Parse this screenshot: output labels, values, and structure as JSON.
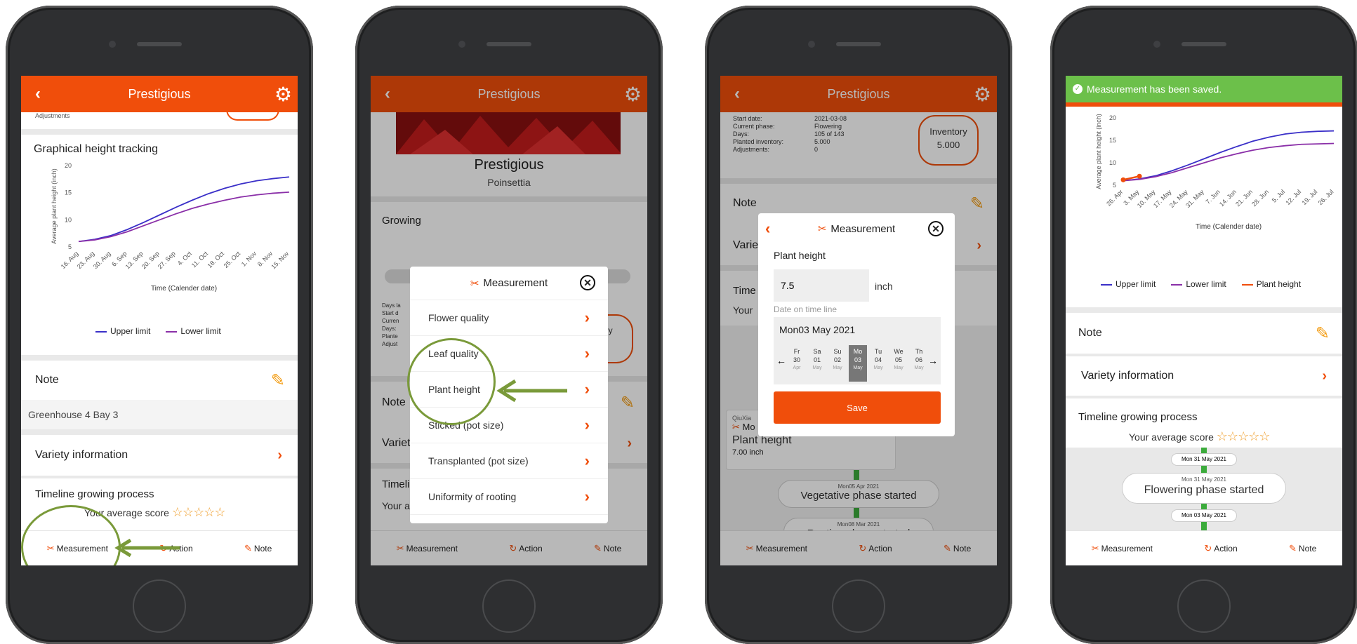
{
  "app": {
    "title": "Prestigious",
    "variety": "Poinsettia"
  },
  "tabs": {
    "measurement": "Measurement",
    "action": "Action",
    "note": "Note"
  },
  "screen1": {
    "adjust_label": "Adjustments",
    "chart_title": "Graphical height tracking",
    "note_label": "Note",
    "note_text": "Greenhouse 4 Bay 3",
    "variety_info": "Variety information",
    "timeline": "Timeline growing process",
    "avg_score": "Your average score"
  },
  "chart_data": [
    {
      "type": "line",
      "title": "Graphical height tracking",
      "xlabel": "Time (Calender date)",
      "ylabel": "Average plant height (inch)",
      "ylim": [
        5,
        20
      ],
      "yticks": [
        5,
        10,
        15,
        20
      ],
      "categories": [
        "16. Aug",
        "23. Aug",
        "30. Aug",
        "6. Sep",
        "13. Sep",
        "20. Sep",
        "27. Sep",
        "4. Oct",
        "11. Oct",
        "18. Oct",
        "25. Oct",
        "1. Nov",
        "8. Nov",
        "15. Nov"
      ],
      "series": [
        {
          "name": "Upper limit",
          "color": "#3a2fc8",
          "values": [
            6,
            6.4,
            7.1,
            8.2,
            9.5,
            10.9,
            12.3,
            13.6,
            14.8,
            15.8,
            16.6,
            17.2,
            17.6,
            17.9
          ]
        },
        {
          "name": "Lower limit",
          "color": "#8a2fa8",
          "values": [
            6,
            6.3,
            6.9,
            7.8,
            8.9,
            10.0,
            11.1,
            12.1,
            12.9,
            13.6,
            14.2,
            14.6,
            14.9,
            15.1
          ]
        }
      ],
      "legend": "bottom"
    },
    {
      "type": "line",
      "xlabel": "Time (Calender date)",
      "ylabel": "Average plant height (inch)",
      "ylim": [
        5,
        20
      ],
      "yticks": [
        5,
        10,
        15,
        20
      ],
      "categories": [
        "26. Apr",
        "3. May",
        "10. May",
        "17. May",
        "24. May",
        "31. May",
        "7. Jun",
        "14. Jun",
        "21. Jun",
        "28. Jun",
        "5. Jul",
        "12. Jul",
        "19. Jul",
        "26. Jul"
      ],
      "series": [
        {
          "name": "Upper limit",
          "color": "#3a2fc8",
          "values": [
            6,
            6.4,
            7.1,
            8.2,
            9.5,
            10.9,
            12.3,
            13.6,
            14.8,
            15.7,
            16.4,
            16.8,
            17.0,
            17.1
          ]
        },
        {
          "name": "Lower limit",
          "color": "#8a2fa8",
          "values": [
            6,
            6.3,
            6.9,
            7.8,
            8.9,
            10.0,
            11.1,
            12.0,
            12.8,
            13.4,
            13.8,
            14.1,
            14.2,
            14.3
          ]
        },
        {
          "name": "Plant height",
          "color": "#f04e0b",
          "values": [
            6.2,
            7.0
          ]
        }
      ],
      "legend": "bottom"
    }
  ],
  "screen2": {
    "note_label": "Note",
    "variety_info": "Variety information",
    "grow_label": "Growing",
    "timeline": "Timeline growing process",
    "avg_score": "Your average score",
    "modal_title": "Measurement",
    "menu": [
      "Flower quality",
      "Leaf quality",
      "Plant height",
      "Sticked (pot size)",
      "Transplanted (pot size)",
      "Uniformity of rooting"
    ],
    "inventory_partial": "ory",
    "side_labels": [
      "Days la",
      "Start d",
      "Curren",
      "Days:",
      "Plante",
      "Adjust"
    ]
  },
  "screen3": {
    "info": [
      {
        "label": "Start date:",
        "value": "2021-03-08"
      },
      {
        "label": "Current phase:",
        "value": "Flowering"
      },
      {
        "label": "Days:",
        "value": "105 of 143"
      },
      {
        "label": "Planted inventory:",
        "value": "5.000"
      },
      {
        "label": "Adjustments:",
        "value": "0"
      }
    ],
    "inventory_label": "Inventory",
    "inventory_value": "5.000",
    "note_label": "Note",
    "variety_partial": "Varie",
    "time_partial": "Time",
    "your_partial": "Your",
    "modal_title": "Measurement",
    "field_label": "Plant height",
    "value": "7.5",
    "unit": "inch",
    "date_label": "Date on time line",
    "date_value": "Mon03 May 2021",
    "days": [
      {
        "dow": "Fr",
        "day": "30",
        "mon": "Apr"
      },
      {
        "dow": "Sa",
        "day": "01",
        "mon": "May"
      },
      {
        "dow": "Su",
        "day": "02",
        "mon": "May"
      },
      {
        "dow": "Mo",
        "day": "03",
        "mon": "May"
      },
      {
        "dow": "Tu",
        "day": "04",
        "mon": "May"
      },
      {
        "dow": "We",
        "day": "05",
        "mon": "May"
      },
      {
        "dow": "Th",
        "day": "06",
        "mon": "May"
      }
    ],
    "save": "Save",
    "card_user": "QiuXia",
    "card_icon_text": "Mo",
    "card_title": "Plant height",
    "card_value": "7.00 inch",
    "ev1_date": "Mon05 Apr 2021",
    "ev1_text": "Vegetative phase started",
    "ev2_date": "Mon08 Mar 2021",
    "ev2_text": "Rooting phase started"
  },
  "screen4": {
    "toast": "Measurement has been saved.",
    "note_label": "Note",
    "variety_info": "Variety information",
    "timeline": "Timeline growing process",
    "avg_score": "Your average score",
    "d1": "Mon 31 May 2021",
    "d2": "Mon 31 May 2021",
    "event": "Flowering phase started",
    "d3": "Mon 03 May 2021"
  }
}
